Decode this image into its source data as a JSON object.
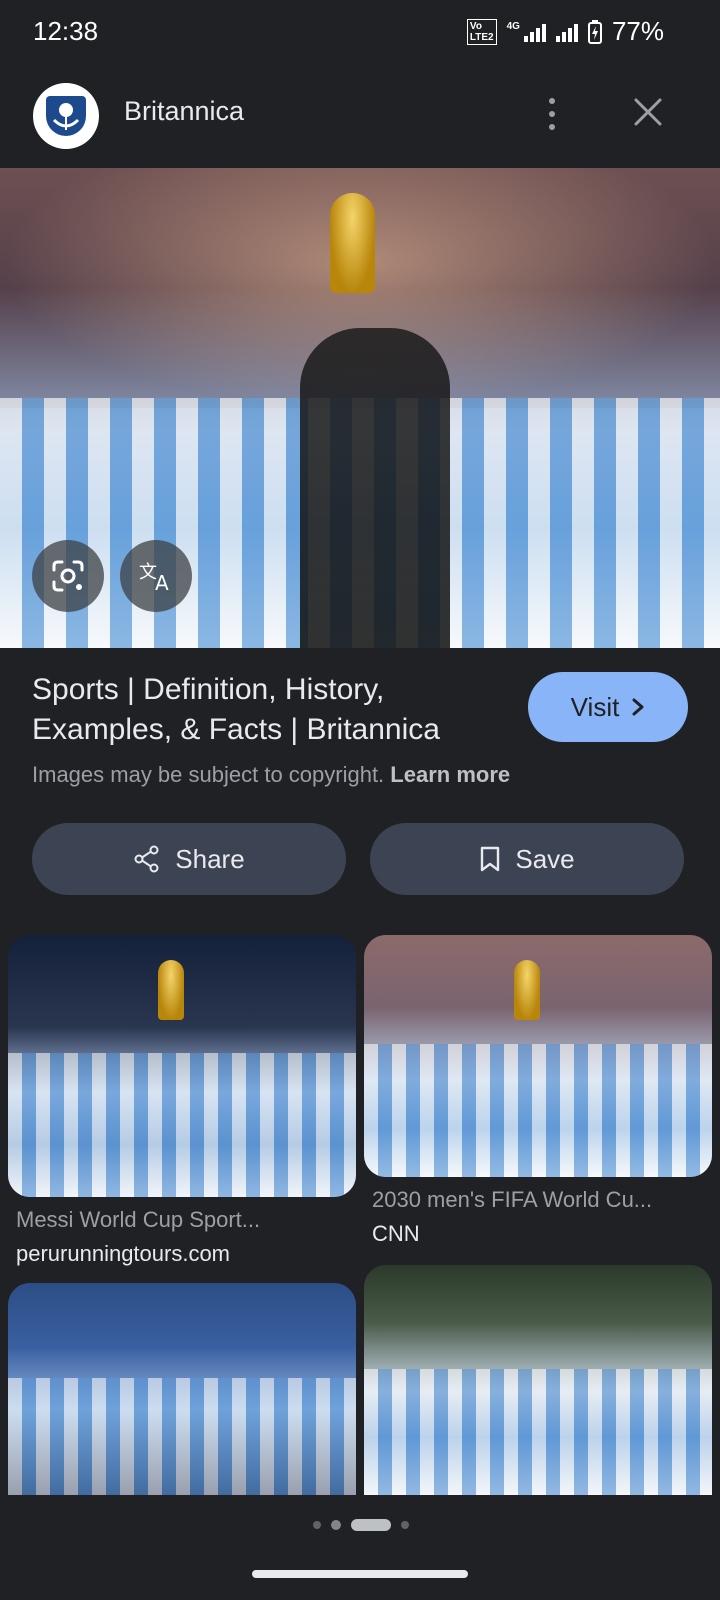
{
  "status_bar": {
    "time": "12:38",
    "volte_top": "Vo",
    "volte_bottom": "LTE2",
    "network": "4G",
    "battery": "77%"
  },
  "header": {
    "site_name": "Britannica",
    "logo_icon": "britannica-thistle-logo",
    "more_icon": "more-vert-icon",
    "close_icon": "close-icon"
  },
  "hero": {
    "lens_icon": "google-lens-icon",
    "translate_icon": "translate-icon"
  },
  "result": {
    "title_line1": "Sports | Definition, History,",
    "title_line2": "Examples, & Facts | Britannica",
    "visit_label": "Visit",
    "copyright_text": "Images may be subject to copyright.",
    "learn_more": "Learn more"
  },
  "actions": {
    "share_label": "Share",
    "save_label": "Save"
  },
  "related": [
    {
      "title": "Messi World Cup Sport...",
      "source": "perurunningtours.com"
    },
    {
      "title": "2030 men's FIFA World Cu...",
      "source": "CNN"
    }
  ],
  "colors": {
    "background": "#202124",
    "accent": "#8ab4f8",
    "button_bg": "#3c4453"
  }
}
